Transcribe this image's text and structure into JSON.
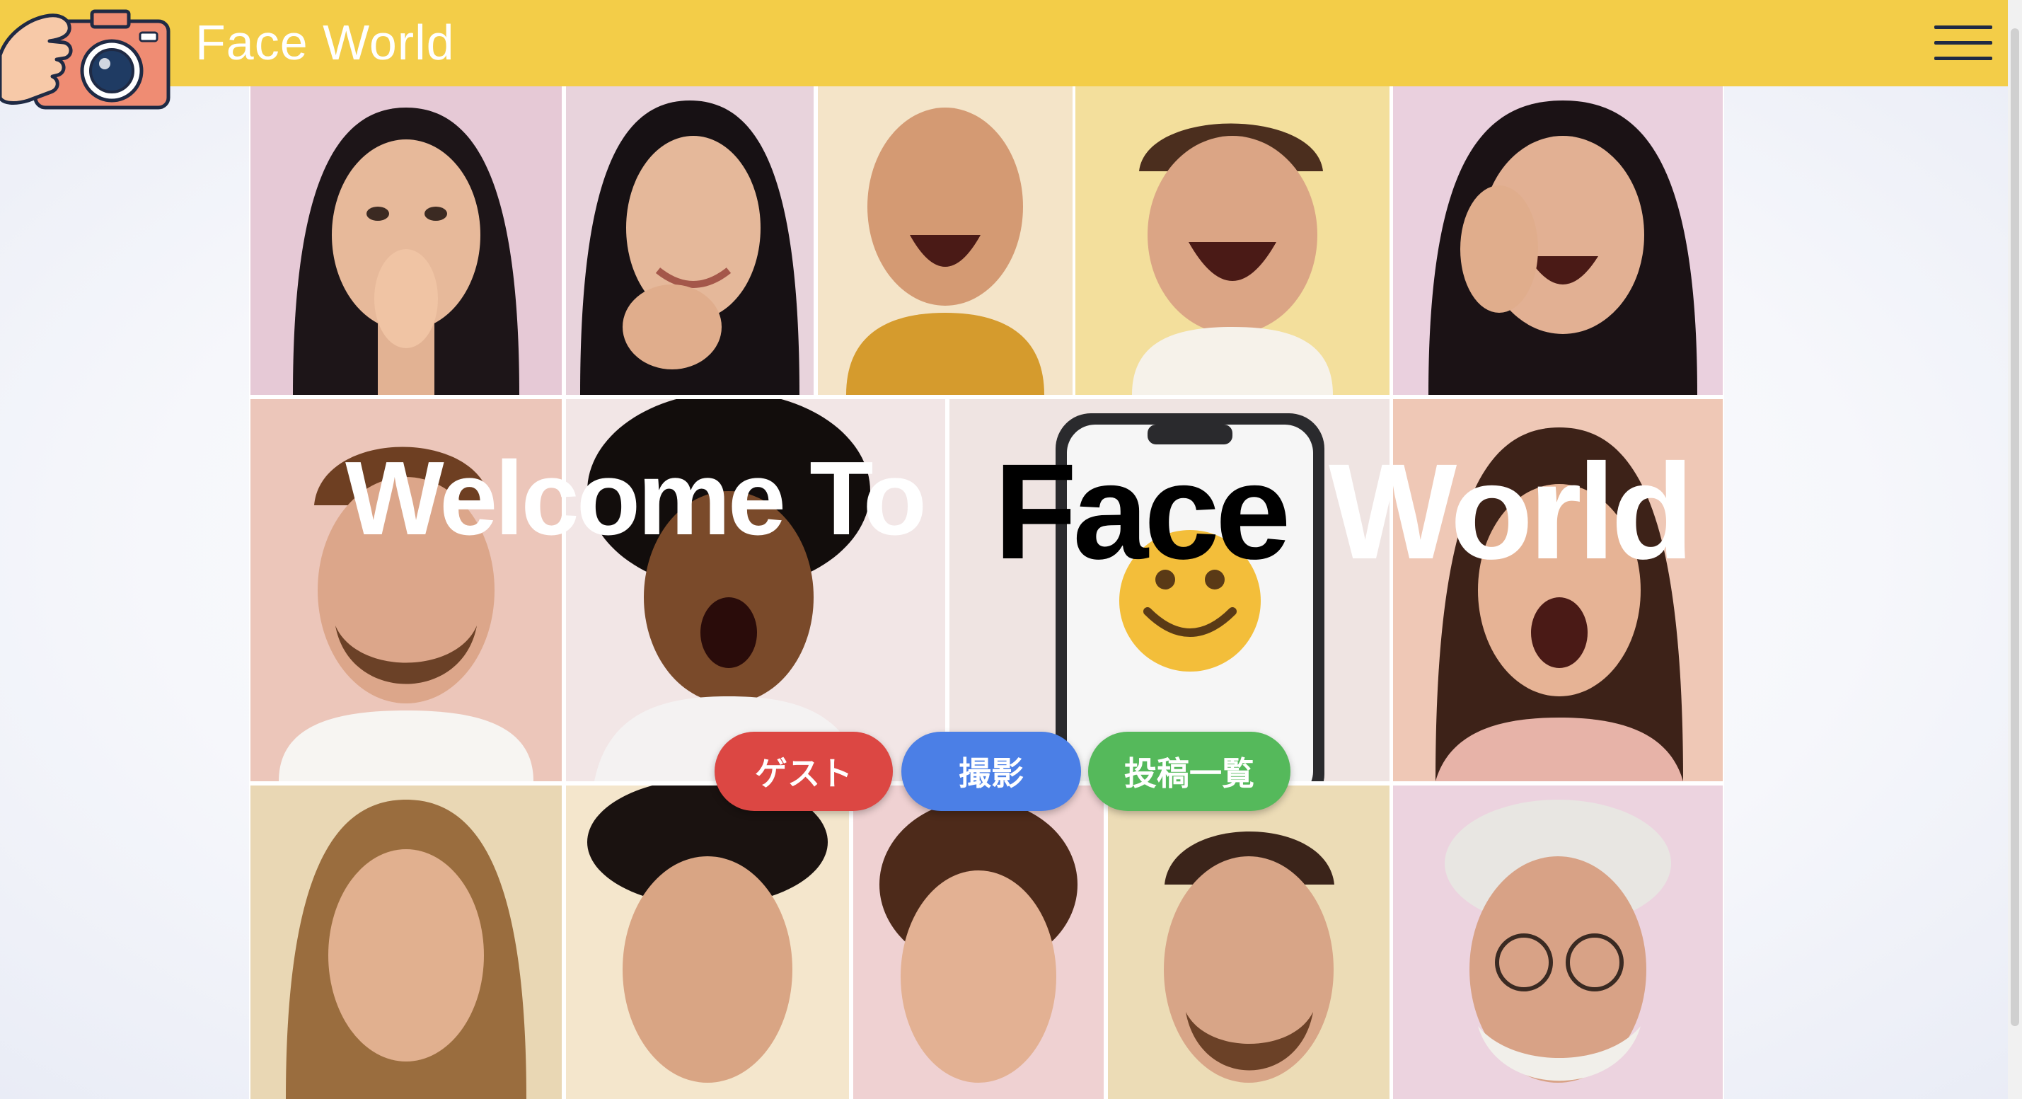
{
  "header": {
    "brand_title": "Face World",
    "menu_icon": "hamburger-menu-icon",
    "background_color": "#f3cd48"
  },
  "hero": {
    "welcome_text": "Welcome To",
    "face_text": "Face",
    "world_text": "World"
  },
  "buttons": {
    "guest_label": "ゲスト",
    "shoot_label": "撮影",
    "posts_label": "投稿一覧",
    "guest_color": "#dc4743",
    "shoot_color": "#4b7fe6",
    "posts_color": "#55b95b"
  },
  "collage": {
    "tiles": [
      "woman-surprised-hands-on-mouth",
      "woman-smiling-hand-on-chin",
      "old-man-laughing",
      "man-laughing",
      "woman-laughing-hand-on-face",
      "man-smiling-beard",
      "man-shocked-afro",
      "smartphone-smiley-emoji",
      "woman-surprised",
      "woman-neutral-long-hair",
      "man-surprised-messy-hair",
      "woman-neutral-short-hair",
      "man-neutral-beard",
      "old-man-glasses-frowning"
    ]
  }
}
